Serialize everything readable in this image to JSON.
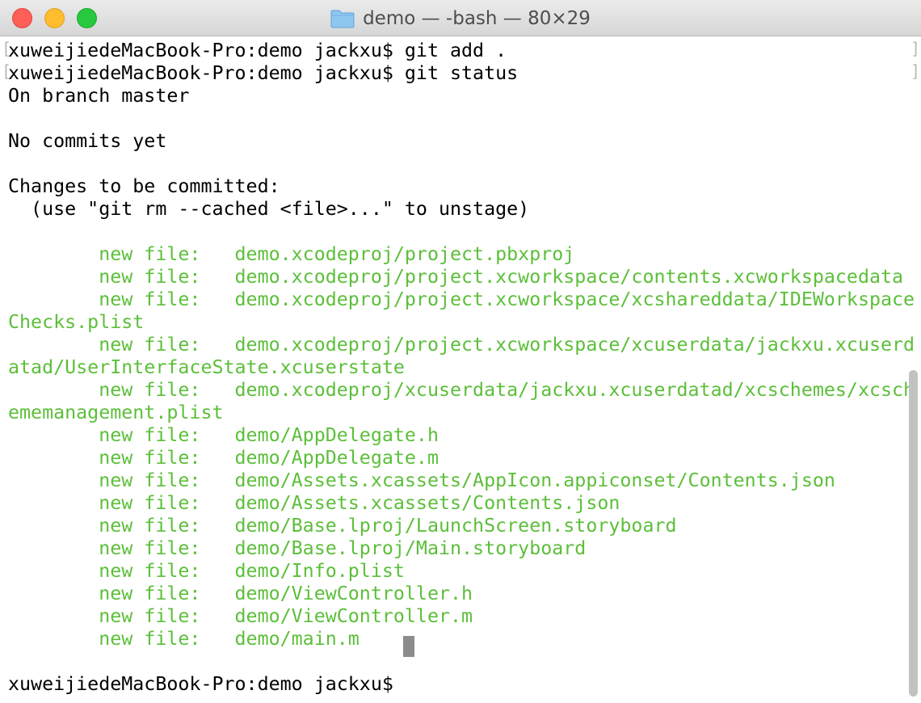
{
  "window": {
    "title": "demo — -bash — 80×29"
  },
  "terminal": {
    "lines": [
      {
        "text": "xuweijiedeMacBook-Pro:demo jackxu$ git add .",
        "color": "#000000"
      },
      {
        "text": "xuweijiedeMacBook-Pro:demo jackxu$ git status",
        "color": "#000000"
      },
      {
        "text": "On branch master",
        "color": "#000000"
      },
      {
        "text": "",
        "color": "#000000"
      },
      {
        "text": "No commits yet",
        "color": "#000000"
      },
      {
        "text": "",
        "color": "#000000"
      },
      {
        "text": "Changes to be committed:",
        "color": "#000000"
      },
      {
        "text": "  (use \"git rm --cached <file>...\" to unstage)",
        "color": "#000000"
      },
      {
        "text": "",
        "color": "#000000"
      },
      {
        "text": "        new file:   demo.xcodeproj/project.pbxproj",
        "color": "#5cbf3a"
      },
      {
        "text": "        new file:   demo.xcodeproj/project.xcworkspace/contents.xcworkspacedata",
        "color": "#5cbf3a"
      },
      {
        "text": "        new file:   demo.xcodeproj/project.xcworkspace/xcshareddata/IDEWorkspace",
        "color": "#5cbf3a"
      },
      {
        "text": "Checks.plist",
        "color": "#5cbf3a"
      },
      {
        "text": "        new file:   demo.xcodeproj/project.xcworkspace/xcuserdata/jackxu.xcuserd",
        "color": "#5cbf3a"
      },
      {
        "text": "atad/UserInterfaceState.xcuserstate",
        "color": "#5cbf3a"
      },
      {
        "text": "        new file:   demo.xcodeproj/xcuserdata/jackxu.xcuserdatad/xcschemes/xcsch",
        "color": "#5cbf3a"
      },
      {
        "text": "ememanagement.plist",
        "color": "#5cbf3a"
      },
      {
        "text": "        new file:   demo/AppDelegate.h",
        "color": "#5cbf3a"
      },
      {
        "text": "        new file:   demo/AppDelegate.m",
        "color": "#5cbf3a"
      },
      {
        "text": "        new file:   demo/Assets.xcassets/AppIcon.appiconset/Contents.json",
        "color": "#5cbf3a"
      },
      {
        "text": "        new file:   demo/Assets.xcassets/Contents.json",
        "color": "#5cbf3a"
      },
      {
        "text": "        new file:   demo/Base.lproj/LaunchScreen.storyboard",
        "color": "#5cbf3a"
      },
      {
        "text": "        new file:   demo/Base.lproj/Main.storyboard",
        "color": "#5cbf3a"
      },
      {
        "text": "        new file:   demo/Info.plist",
        "color": "#5cbf3a"
      },
      {
        "text": "        new file:   demo/ViewController.h",
        "color": "#5cbf3a"
      },
      {
        "text": "        new file:   demo/ViewController.m",
        "color": "#5cbf3a"
      },
      {
        "text": "        new file:   demo/main.m",
        "color": "#5cbf3a"
      },
      {
        "text": "",
        "color": "#000000"
      },
      {
        "text": "xuweijiedeMacBook-Pro:demo jackxu$ ",
        "color": "#000000"
      }
    ]
  },
  "colors": {
    "staged_file": "#5cbf3a",
    "cursor": "#8c8c8c",
    "close": "#fe5f57",
    "minimize": "#febc2e",
    "zoom": "#28c840"
  },
  "icons": {
    "title": "folder-icon"
  }
}
